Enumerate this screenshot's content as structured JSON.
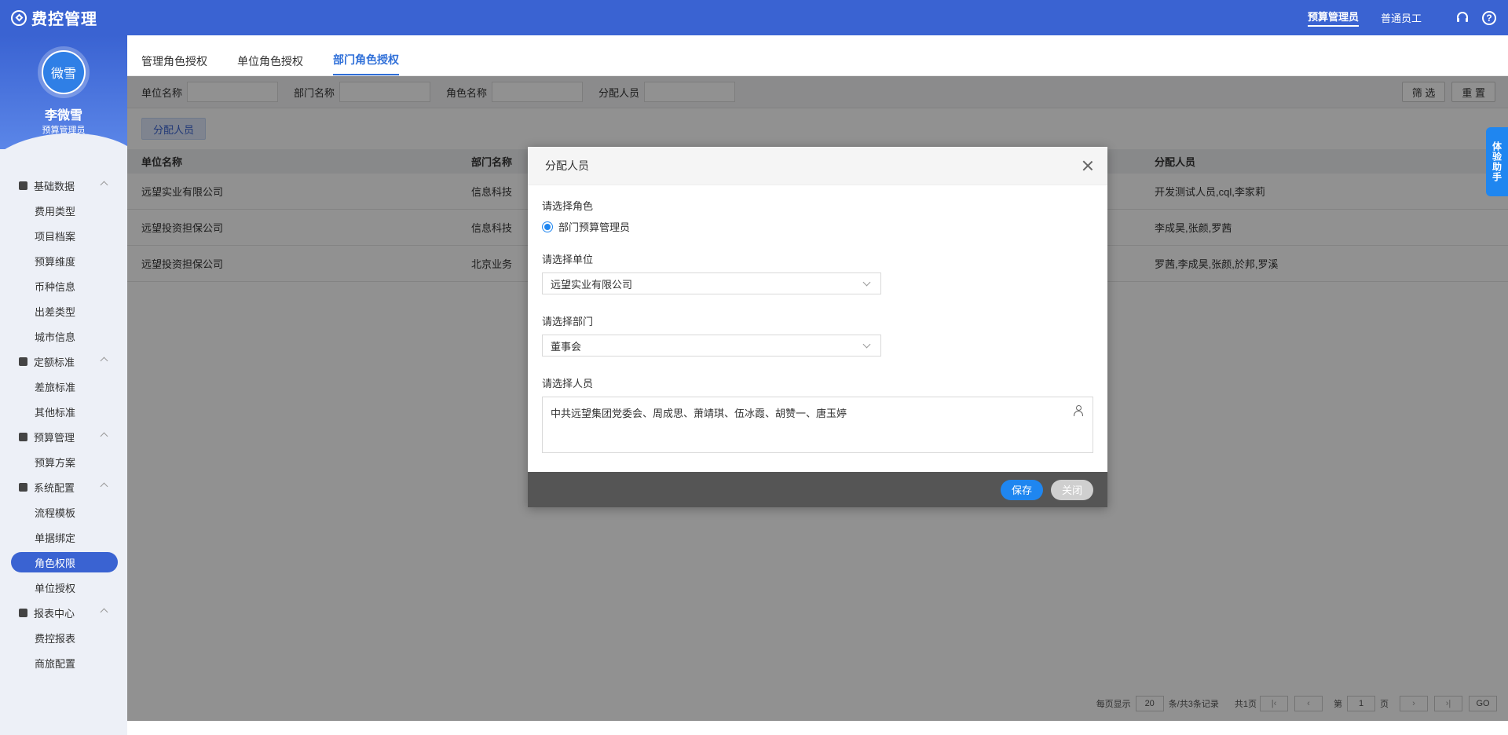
{
  "app": {
    "title": "费控管理"
  },
  "header": {
    "roles": [
      "预算管理员",
      "普通员工"
    ],
    "active_role": "预算管理员"
  },
  "user": {
    "avatar_text": "微雪",
    "name": "李微雪",
    "role": "预算管理员"
  },
  "sidebar": {
    "groups": [
      {
        "label": "基础数据",
        "items": [
          "费用类型",
          "项目档案",
          "预算维度",
          "币种信息",
          "出差类型",
          "城市信息"
        ]
      },
      {
        "label": "定额标准",
        "items": [
          "差旅标准",
          "其他标准"
        ]
      },
      {
        "label": "预算管理",
        "items": [
          "预算方案"
        ]
      },
      {
        "label": "系统配置",
        "items": [
          "流程模板",
          "单据绑定",
          "角色权限",
          "单位授权"
        ]
      },
      {
        "label": "报表中心",
        "items": [
          "费控报表",
          "商旅配置"
        ]
      }
    ],
    "active_item": "角色权限"
  },
  "tabs": [
    "管理角色授权",
    "单位角色授权",
    "部门角色授权"
  ],
  "active_tab": "部门角色授权",
  "filters": {
    "labels": [
      "单位名称",
      "部门名称",
      "角色名称",
      "分配人员"
    ],
    "filter_btn": "筛 选",
    "reset_btn": "重 置"
  },
  "actions": {
    "assign_btn": "分配人员"
  },
  "table": {
    "headers": [
      "单位名称",
      "部门名称",
      "",
      "分配人员"
    ],
    "rows": [
      [
        "远望实业有限公司",
        "信息科技",
        "",
        "开发测试人员,cql,李家莉"
      ],
      [
        "远望投资担保公司",
        "信息科技",
        "",
        "李成昊,张颜,罗茜"
      ],
      [
        "远望投资担保公司",
        "北京业务",
        "",
        "罗茜,李成昊,张颜,於邦,罗溪"
      ]
    ]
  },
  "pager": {
    "per_page_label": "每页显示",
    "per_page": "20",
    "records": "条/共3条记录",
    "total_pages": "共1页",
    "page_prefix": "第",
    "page": "1",
    "page_suffix": "页",
    "go": "GO"
  },
  "assistant": {
    "label": "体验助手"
  },
  "modal": {
    "title": "分配人员",
    "role_label": "请选择角色",
    "role_option": "部门预算管理员",
    "unit_label": "请选择单位",
    "unit_value": "远望实业有限公司",
    "dept_label": "请选择部门",
    "dept_value": "董事会",
    "people_label": "请选择人员",
    "people_value": "中共远望集团党委会、周成思、萧靖琪、伍冰霞、胡赞一、唐玉婷",
    "save_btn": "保存",
    "close_btn": "关闭"
  }
}
